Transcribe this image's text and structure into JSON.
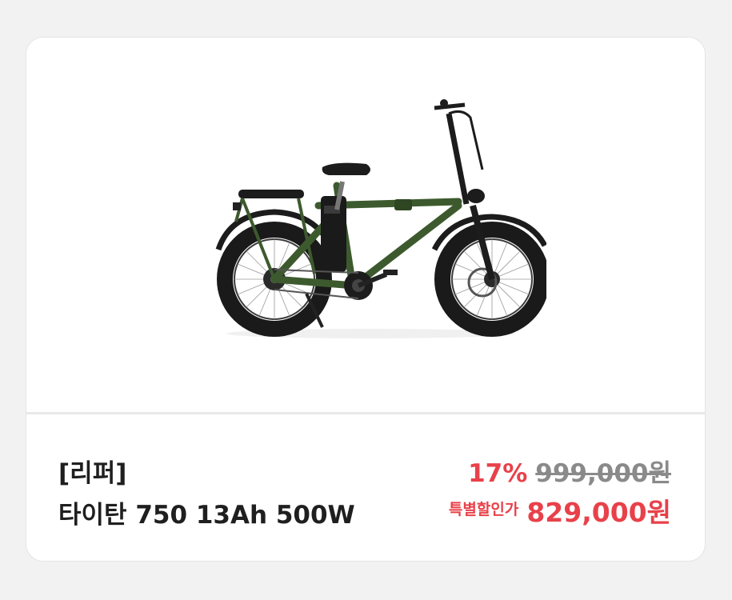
{
  "product": {
    "image_alt": "electric folding bike",
    "brand": "[리퍼]",
    "name": "타이탄 750 13Ah 500W",
    "discount_rate": "17%",
    "original_price": "999,000원",
    "sale_label": "특별할인가",
    "sale_price": "829,000원"
  },
  "colors": {
    "accent": "#e8414a",
    "frame": "#3d5a2e",
    "text": "#1f1f1f",
    "muted": "#8a8a8a"
  }
}
